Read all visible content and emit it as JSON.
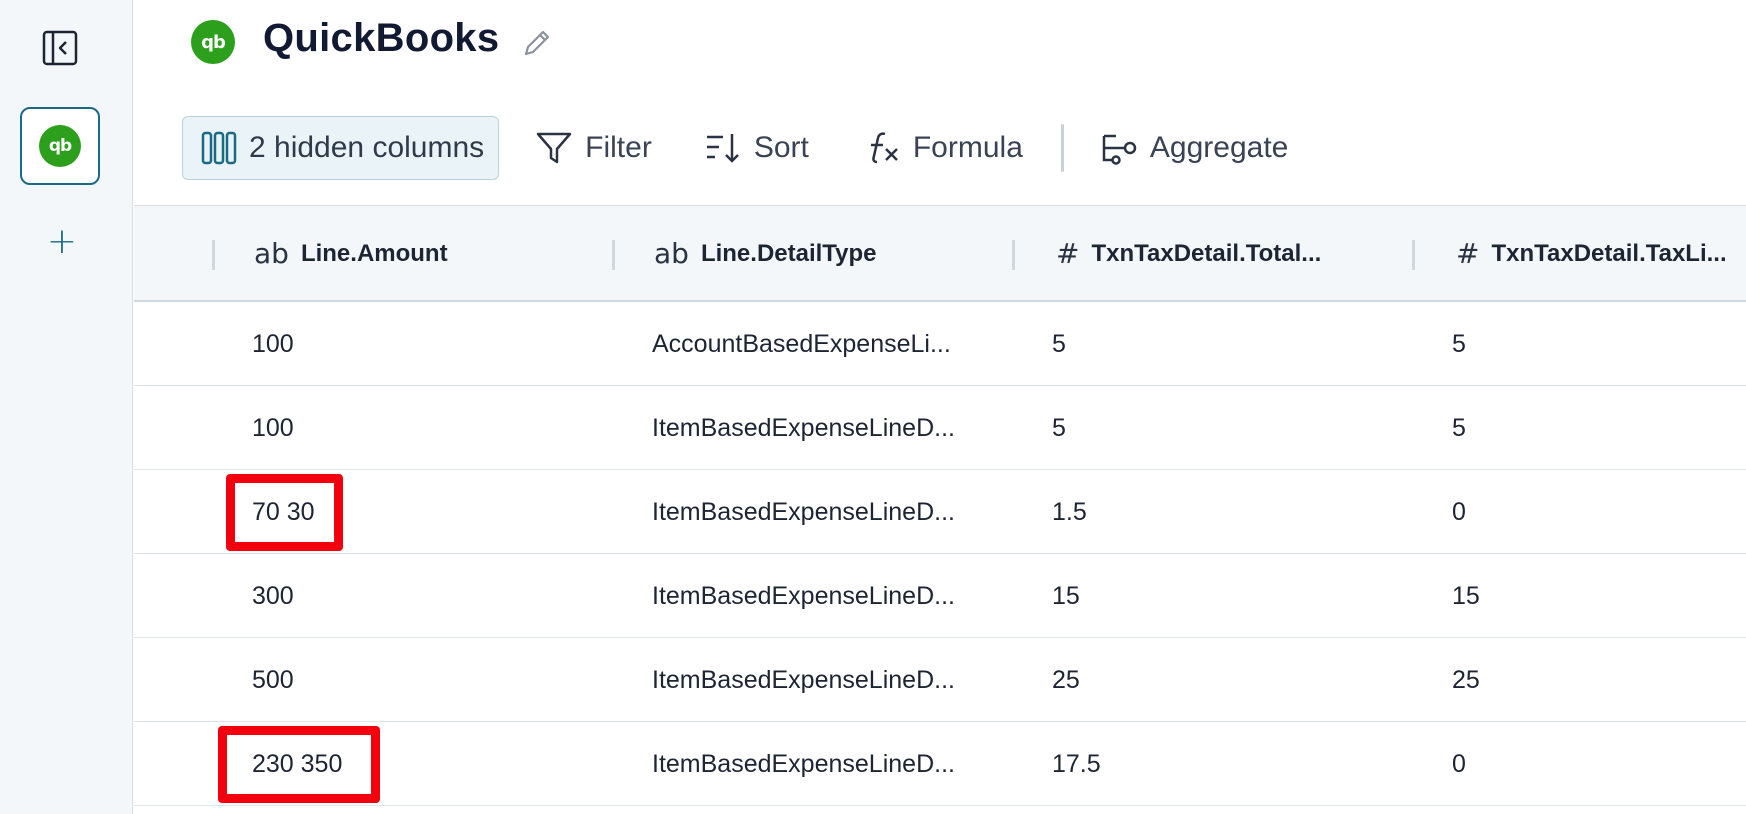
{
  "app": {
    "title": "QuickBooks",
    "logo_text": "qb",
    "brand_color": "#2ca01c",
    "accent_color": "#1a6a84",
    "highlight_color": "#f2000d"
  },
  "sidebar": {
    "collapse_icon": "sidebar-collapse-icon",
    "source_logo_text": "qb",
    "add_label": "+"
  },
  "toolbar": {
    "hidden_columns_label": "2 hidden columns",
    "filter_label": "Filter",
    "sort_label": "Sort",
    "formula_label": "Formula",
    "aggregate_label": "Aggregate"
  },
  "table": {
    "columns": [
      {
        "type_icon": "ab",
        "label": "Line.Amount"
      },
      {
        "type_icon": "ab",
        "label": "Line.DetailType"
      },
      {
        "type_icon": "#",
        "label": "TxnTaxDetail.Total..."
      },
      {
        "type_icon": "#",
        "label": "TxnTaxDetail.TaxLi..."
      }
    ],
    "rows": [
      [
        "100",
        "AccountBasedExpenseLi...",
        "5",
        "5"
      ],
      [
        "100",
        "ItemBasedExpenseLineD...",
        "5",
        "5"
      ],
      [
        "70 30",
        "ItemBasedExpenseLineD...",
        "1.5",
        "0"
      ],
      [
        "300",
        "ItemBasedExpenseLineD...",
        "15",
        "15"
      ],
      [
        "500",
        "ItemBasedExpenseLineD...",
        "25",
        "25"
      ],
      [
        "230 350",
        "ItemBasedExpenseLineD...",
        "17.5",
        "0"
      ]
    ]
  }
}
